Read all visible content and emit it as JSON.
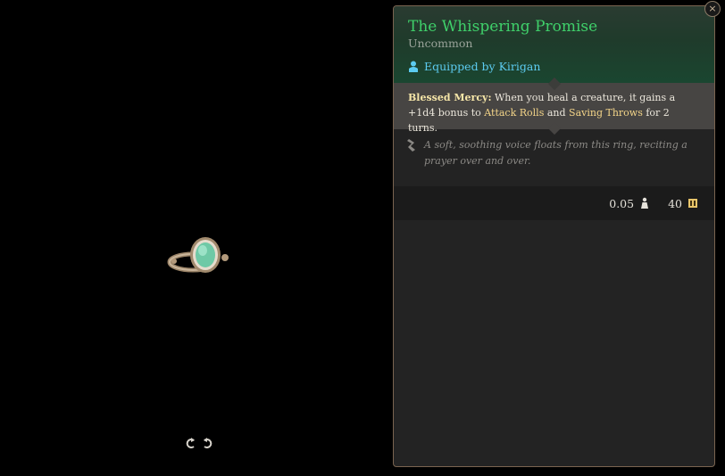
{
  "item": {
    "name": "The Whispering Promise",
    "rarity": "Uncommon",
    "equipped_by": "Equipped by Kirigan"
  },
  "effect": {
    "name": "Blessed Mercy:",
    "text_1": " When you heal a creature, it gains a +1d4 bonus to ",
    "kw_1": "Attack Rolls",
    "text_2": " and ",
    "kw_2": "Saving Throws",
    "text_3": " for 2 turns."
  },
  "flavor": "A soft, soothing voice floats from this ring, reciting a prayer over and over.",
  "stats": {
    "weight": "0.05",
    "value": "40"
  },
  "close_label": "×",
  "colors": {
    "name_green": "#3fd06a",
    "equipped_blue": "#5ccbf0",
    "keyword_gold": "#f3d488"
  },
  "icons": {
    "rotate_left": "rotate-left-icon",
    "rotate_right": "rotate-right-icon",
    "equipped": "character-icon",
    "flavor": "quill-icon",
    "weight": "weight-icon",
    "value": "gold-coin-icon",
    "close": "close-icon"
  }
}
